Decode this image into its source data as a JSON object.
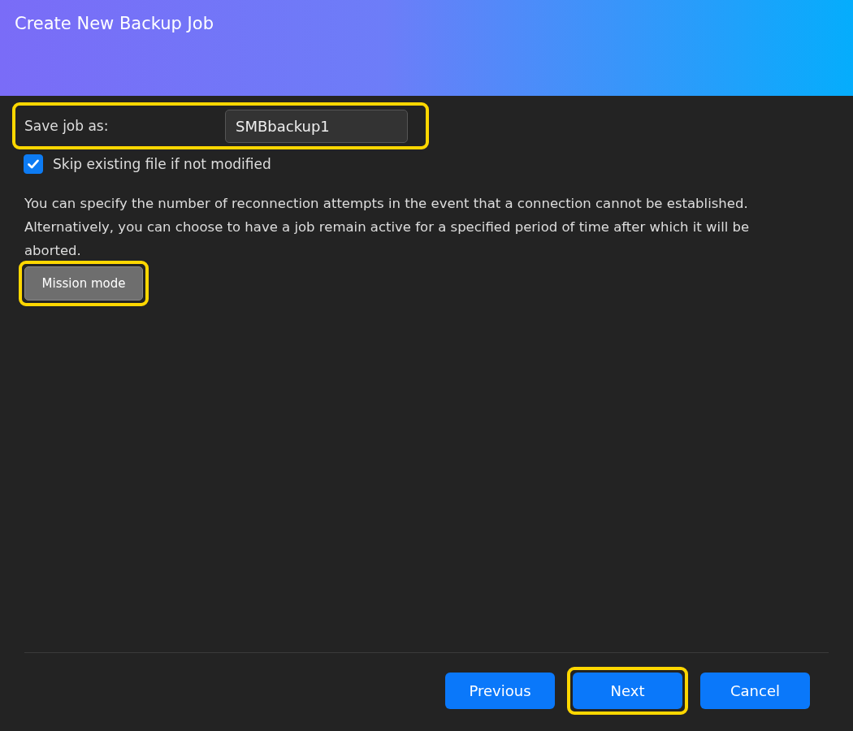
{
  "window": {
    "title": "Create New Backup Job"
  },
  "save_job": {
    "label": "Save job as:",
    "value": "SMBbackup1",
    "highlighted": true
  },
  "skip_existing": {
    "label": "Skip existing file if not modified",
    "checked": true
  },
  "description": "You can specify the number of reconnection attempts in the event that a connection cannot be established. Alternatively, you can choose to have a job remain active for a specified period of time after which it will be aborted.",
  "mission_mode": {
    "label": "Mission mode",
    "highlighted": true
  },
  "buttons": [
    {
      "label": "Previous",
      "highlighted": false
    },
    {
      "label": "Next",
      "highlighted": true
    },
    {
      "label": "Cancel",
      "highlighted": false
    }
  ]
}
